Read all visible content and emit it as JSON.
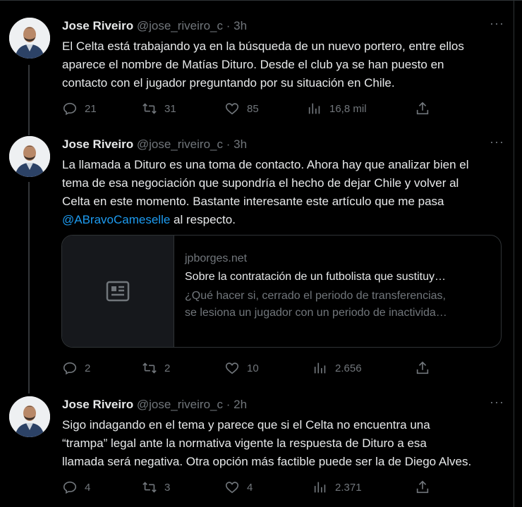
{
  "tweets": [
    {
      "name": "Jose Riveiro",
      "handle": "@jose_riveiro_c",
      "dot": "·",
      "time": "3h",
      "more": "···",
      "text_lines": [
        "El Celta está trabajando ya en la búsqueda de un nuevo portero, entre ellos",
        "aparece el nombre de Matías Dituro. Desde el club ya se han puesto en",
        "contacto con el jugador preguntando por su situación en Chile."
      ],
      "replies": "21",
      "retweets": "31",
      "likes": "85",
      "views": "16,8 mil"
    },
    {
      "name": "Jose Riveiro",
      "handle": "@jose_riveiro_c",
      "dot": "·",
      "time": "3h",
      "more": "···",
      "text_lines": [
        "La llamada a Dituro es una toma de contacto. Ahora hay que analizar bien el",
        "tema de esa negociación que supondría el hecho de dejar Chile y volver al",
        "Celta en este momento. Bastante interesante este artículo que me pasa"
      ],
      "mention": "@ABravoCameselle",
      "after_mention": " al respecto.",
      "card": {
        "domain": "jpborges.net",
        "title": "Sobre la contratación de un futbolista que sustituy…",
        "desc_line1": "¿Qué hacer si, cerrado el periodo de transferencias,",
        "desc_line2": "se lesiona un jugador con un periodo de inactivida…"
      },
      "replies": "2",
      "retweets": "2",
      "likes": "10",
      "views": "2.656"
    },
    {
      "name": "Jose Riveiro",
      "handle": "@jose_riveiro_c",
      "dot": "·",
      "time": "2h",
      "more": "···",
      "text_lines": [
        "Sigo indagando en el tema y parece que si el Celta no encuentra una",
        "“trampa” legal ante la normativa vigente la respuesta de Dituro a esa",
        "llamada será negativa. Otra opción más factible puede ser la de Diego Alves."
      ],
      "replies": "4",
      "retweets": "3",
      "likes": "4",
      "views": "2.371"
    }
  ],
  "icons": {
    "reply": "reply-icon",
    "retweet": "retweet-icon",
    "like": "like-icon",
    "views": "views-icon",
    "share": "share-icon",
    "card": "article-icon"
  },
  "colors": {
    "background": "#000000",
    "text": "#e7e9ea",
    "muted": "#71767b",
    "link": "#1d9bf0",
    "border": "#2f3336"
  }
}
